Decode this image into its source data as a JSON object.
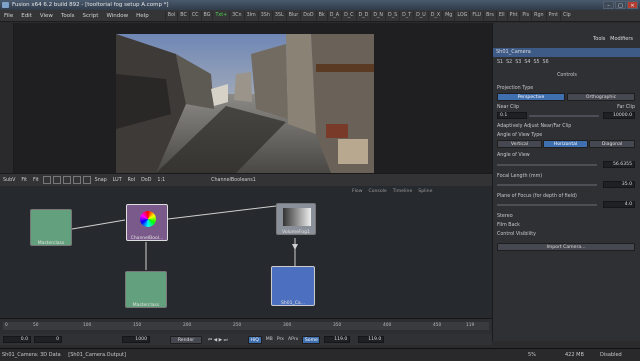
{
  "window": {
    "title": "Fusion x64 6.2 build 892 - [tooltorial fog setup A.comp *]",
    "min": "–",
    "max": "□",
    "close": "✕"
  },
  "menu": [
    "File",
    "Edit",
    "View",
    "Tools",
    "Script",
    "Window",
    "Help"
  ],
  "toolbar_top": [
    "Bol",
    "BC",
    "CC",
    "BG",
    "Txt+",
    "3Cn",
    "3Im",
    "3Sh",
    "3SL",
    "Blur",
    "DoD",
    "Bk",
    "D_A",
    "D_C",
    "D_D",
    "D_N",
    "D_S",
    "D_T",
    "D_U",
    "D_X",
    "Mg",
    "LOG",
    "FLU",
    "Brs",
    "Ell",
    "Pht",
    "Pls",
    "Rgn",
    "Pmt",
    "Clp"
  ],
  "toolbar_active": "Txt+",
  "viewer_bar": {
    "items": [
      "SubV",
      "Fit",
      "Fit"
    ],
    "snap": "Snap",
    "lut": "LUT",
    "roi": "RoI",
    "dod": "DoD",
    "zoom": "1:1",
    "title": "ChannelBooleans1"
  },
  "flow": {
    "tabs": [
      "Flow",
      "Console",
      "Timeline",
      "Spline"
    ],
    "nodes": {
      "masterclass1": "Masterclass",
      "channelbool": "ChannelBool...",
      "volumefog": "VolumeFog1",
      "masterclass2": "Masterclass",
      "camera": "Sh01_Ca..."
    }
  },
  "panel": {
    "tabs": [
      "Tools",
      "Modifiers"
    ],
    "node_name": "Sh01_Camera",
    "sets": [
      "S1",
      "S2",
      "S3",
      "S4",
      "S5",
      "S6"
    ],
    "section_controls": "Controls",
    "projection_type": "Projection Type",
    "perspective": "Perspective",
    "orthographic": "Orthographic",
    "near_clip": "Near Clip",
    "far_clip": "Far Clip",
    "near_val": "0.1",
    "far_val": "10000.0",
    "adaptively": "Adaptively Adjust Near/Far Clip",
    "angle_type": "Angle of View Type",
    "vertical": "Vertical",
    "horizontal": "Horizontal",
    "diagonal": "Diagonal",
    "angle_of_view": "Angle of View",
    "angle_val": "56.6355",
    "focal_length": "Focal Length (mm)",
    "focal_val": "35.0",
    "plane_of_focus": "Plane of Focus (for depth of field)",
    "plane_val": "4.0",
    "stereo": "Stereo",
    "film_back": "Film Back",
    "control_visibility": "Control Visibility",
    "import_camera": "Import Camera..."
  },
  "timeline": {
    "ticks": [
      "0",
      "10",
      "19",
      "50",
      "100",
      "150",
      "200",
      "250",
      "300",
      "350",
      "400",
      "450",
      "500",
      "550",
      "600",
      "650",
      "700",
      "750",
      "800",
      "850",
      "900",
      "950",
      "1000",
      "1050",
      "1100",
      "119"
    ],
    "start": "0.0",
    "start2": "0",
    "end": "1000",
    "current": "0.0",
    "end_field": "119.0",
    "end_field2": "119.0",
    "render": "Render",
    "hq": "HiQ",
    "mb": "MB",
    "prx": "Prx",
    "aprx": "APrx",
    "some": "Some"
  },
  "status": {
    "left": "Sh01_Camera: 3D Data",
    "mid": "[Sh01_Camera.Output]",
    "pct": "5%",
    "mem": "422 MB",
    "disabled": "Disabled"
  },
  "colors": {
    "accent_blue": "#3f6fae",
    "green_active": "#4fd34f",
    "title_blue": "#3a4b61"
  }
}
